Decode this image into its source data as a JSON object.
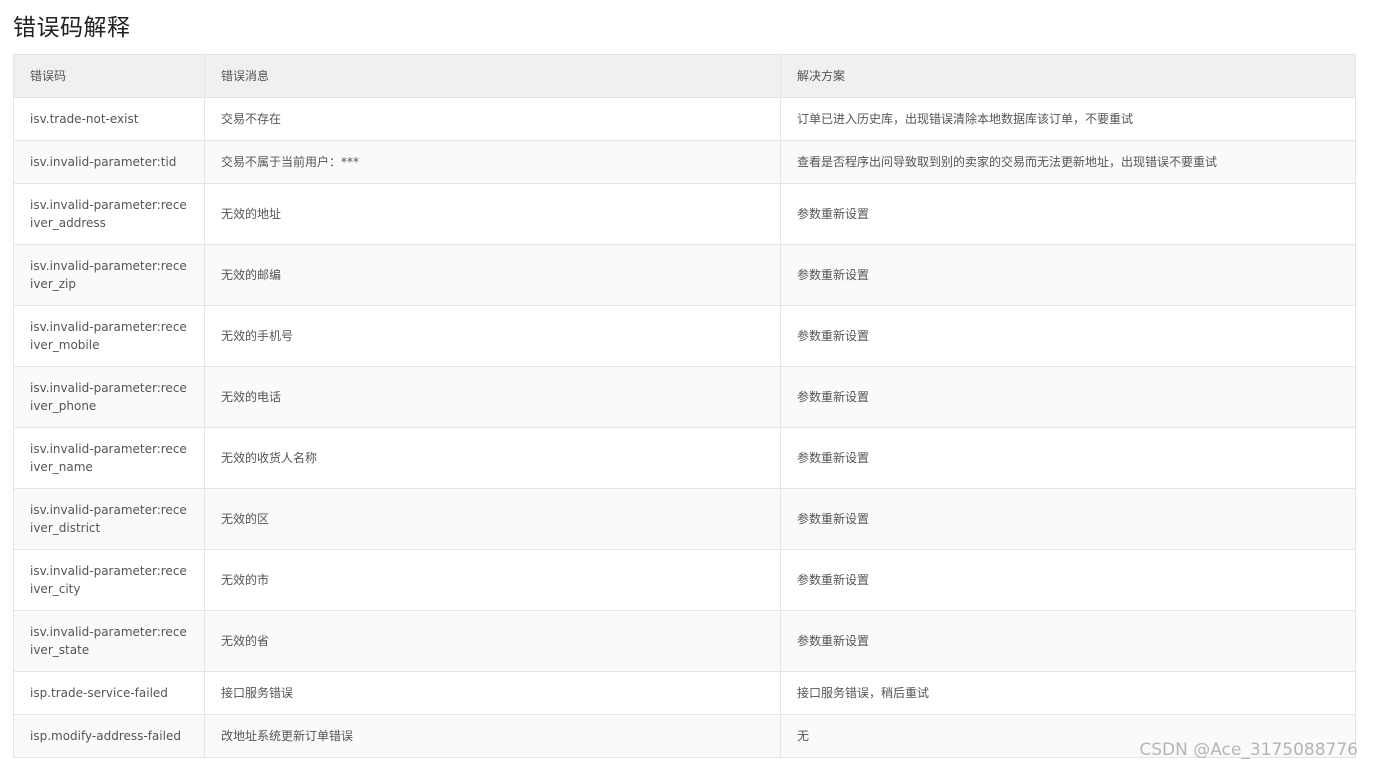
{
  "page": {
    "title": "错误码解释"
  },
  "table": {
    "headers": {
      "code": "错误码",
      "message": "错误消息",
      "solution": "解决方案"
    },
    "rows": [
      {
        "code": "isv.trade-not-exist",
        "message": "交易不存在",
        "solution": "订单已进入历史库，出现错误清除本地数据库该订单，不要重试"
      },
      {
        "code": "isv.invalid-parameter:tid",
        "message": "交易不属于当前用户：***",
        "solution": "查看是否程序出问导致取到别的卖家的交易而无法更新地址，出现错误不要重试"
      },
      {
        "code": "isv.invalid-parameter:receiver_address",
        "message": "无效的地址",
        "solution": "参数重新设置"
      },
      {
        "code": "isv.invalid-parameter:receiver_zip",
        "message": "无效的邮编",
        "solution": "参数重新设置"
      },
      {
        "code": "isv.invalid-parameter:receiver_mobile",
        "message": "无效的手机号",
        "solution": "参数重新设置"
      },
      {
        "code": "isv.invalid-parameter:receiver_phone",
        "message": "无效的电话",
        "solution": "参数重新设置"
      },
      {
        "code": "isv.invalid-parameter:receiver_name",
        "message": "无效的收货人名称",
        "solution": "参数重新设置"
      },
      {
        "code": "isv.invalid-parameter:receiver_district",
        "message": "无效的区",
        "solution": "参数重新设置"
      },
      {
        "code": "isv.invalid-parameter:receiver_city",
        "message": "无效的市",
        "solution": "参数重新设置"
      },
      {
        "code": "isv.invalid-parameter:receiver_state",
        "message": "无效的省",
        "solution": "参数重新设置"
      },
      {
        "code": "isp.trade-service-failed",
        "message": "接口服务错误",
        "solution": "接口服务错误，稍后重试"
      },
      {
        "code": "isp.modify-address-failed",
        "message": "改地址系统更新订单错误",
        "solution": "无"
      }
    ]
  },
  "watermark": "CSDN @Ace_3175088776"
}
